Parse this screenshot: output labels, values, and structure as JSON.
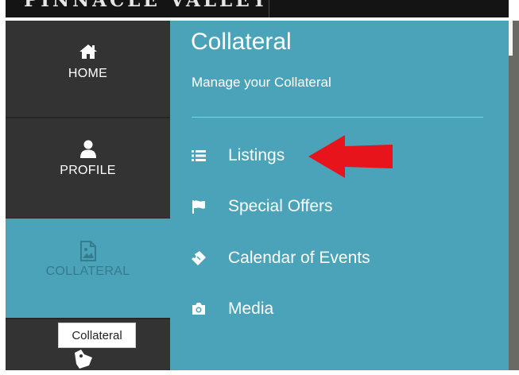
{
  "header": {
    "brand_text": "PINNACLE VALLEY"
  },
  "sidebar": {
    "items": [
      {
        "label": "HOME",
        "icon": "home-icon"
      },
      {
        "label": "PROFILE",
        "icon": "user-icon"
      },
      {
        "label": "COLLATERAL",
        "icon": "image-icon",
        "active": true
      },
      {
        "label": "",
        "icon": "tag-icon"
      }
    ]
  },
  "tooltip": {
    "text": "Collateral"
  },
  "panel": {
    "title": "Collateral",
    "subtitle": "Manage your Collateral",
    "menu": [
      {
        "label": "Listings",
        "icon": "list-icon"
      },
      {
        "label": "Special Offers",
        "icon": "flag-icon"
      },
      {
        "label": "Calendar of Events",
        "icon": "ticket-icon"
      },
      {
        "label": "Media",
        "icon": "camera-icon"
      }
    ]
  },
  "colors": {
    "sidebar_bg": "#333333",
    "panel_bg": "#4aa3b9",
    "active_label": "#367b8c",
    "annotation_arrow": "#e8141c"
  }
}
